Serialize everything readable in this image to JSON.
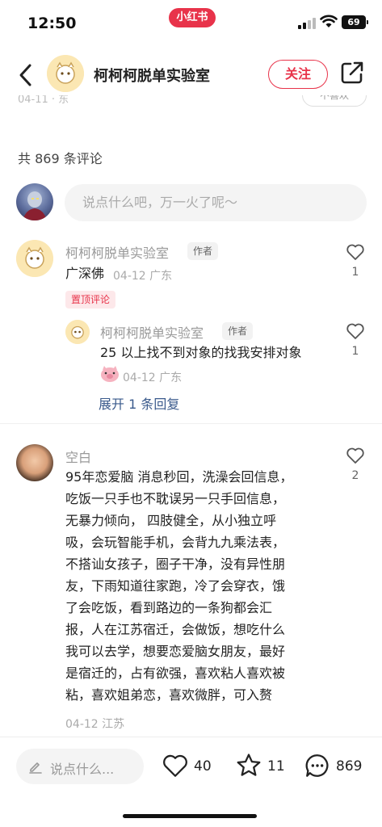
{
  "status_bar": {
    "time": "12:50",
    "app_badge": "小红书",
    "battery": "69"
  },
  "header": {
    "title": "柯柯柯脱单实验室",
    "follow_label": "关注"
  },
  "partial_row": {
    "date": "04-11 · 东",
    "chip": "不喜欢"
  },
  "comments_header": {
    "count_label": "共 869 条评论"
  },
  "comment_input": {
    "placeholder": "说点什么吧，万一火了呢～"
  },
  "comments": [
    {
      "user": "柯柯柯脱单实验室",
      "author_tag": "作者",
      "text": "广深佛",
      "date": "04-12",
      "location": "广东",
      "pinned_label": "置顶评论",
      "likes": "1",
      "reply": {
        "user": "柯柯柯脱单实验室",
        "author_tag": "作者",
        "text": "25 以上找不到对象的找我安排对象",
        "date": "04-12",
        "location": "广东",
        "likes": "1"
      },
      "expand_label": "展开 1 条回复"
    },
    {
      "user": "空白",
      "text_lines": [
        "95年恋爱脑 消息秒回，洗澡会回信息，",
        "吃饭一只手也不耽误另一只手回信息，",
        "无暴力倾向， 四肢健全，从小独立呼",
        "吸，会玩智能手机，会背九九乘法表，",
        "不搭讪女孩子，圈子干净，没有异性朋",
        "友，下雨知道往家跑，冷了会穿衣，饿",
        "了会吃饭，看到路边的一条狗都会汇",
        "报，人在江苏宿迁，会做饭，想吃什么",
        "我可以去学，想要恋爱脑女朋友，最好",
        "是宿迁的，占有欲强，喜欢粘人喜欢被",
        "粘，喜欢姐弟恋，喜欢微胖，可入赘"
      ],
      "date": "04-12",
      "location": "江苏",
      "likes": "2"
    }
  ],
  "bottom_bar": {
    "input_placeholder": "说点什么...",
    "likes": "40",
    "favorites": "11",
    "comments": "869"
  },
  "colors": {
    "accent": "#e8334a",
    "link": "#3a5a8c"
  },
  "icons": [
    "back-icon",
    "share-icon",
    "heart-icon",
    "star-icon",
    "comment-icon",
    "pencil-icon",
    "wifi-icon",
    "signal-icon"
  ]
}
